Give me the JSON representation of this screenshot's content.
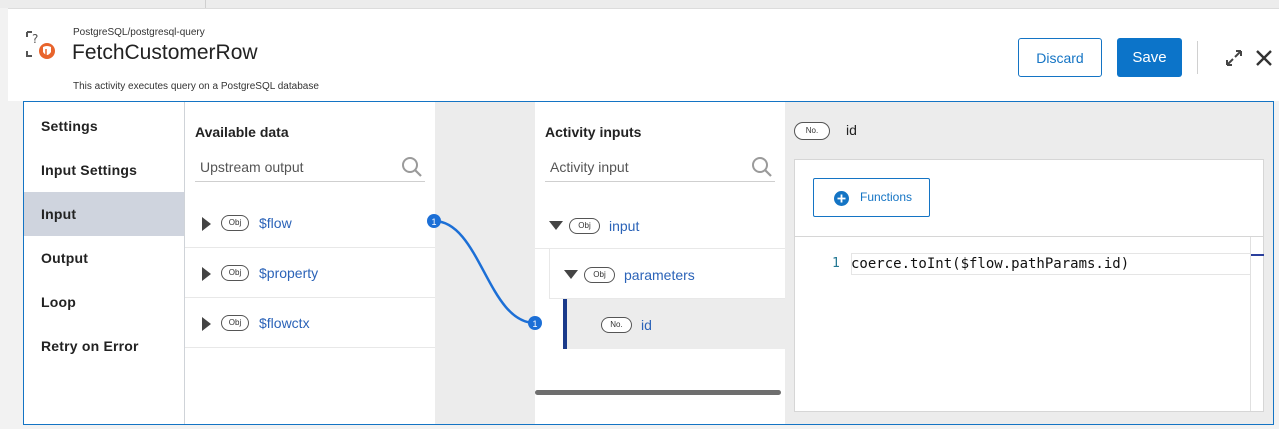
{
  "header": {
    "path": "PostgreSQL/postgresql-query",
    "title": "FetchCustomerRow",
    "description": "This activity executes query on a PostgreSQL database",
    "discard_label": "Discard",
    "save_label": "Save"
  },
  "nav": {
    "items": [
      {
        "label": "Settings"
      },
      {
        "label": "Input Settings"
      },
      {
        "label": "Input"
      },
      {
        "label": "Output"
      },
      {
        "label": "Loop"
      },
      {
        "label": "Retry on Error"
      }
    ],
    "active": "Input"
  },
  "available_data": {
    "title": "Available data",
    "search_placeholder": "Upstream output",
    "rows": [
      {
        "type": "Obj",
        "name": "$flow",
        "mapped_count": "1"
      },
      {
        "type": "Obj",
        "name": "$property"
      },
      {
        "type": "Obj",
        "name": "$flowctx"
      }
    ]
  },
  "activity_inputs": {
    "title": "Activity inputs",
    "search_placeholder": "Activity input",
    "tree": [
      {
        "type": "Obj",
        "name": "input",
        "expanded": true
      },
      {
        "type": "Obj",
        "name": "parameters",
        "expanded": true
      },
      {
        "type": "No.",
        "name": "id",
        "selected": true,
        "mapped_count": "1"
      }
    ]
  },
  "editor": {
    "field_type": "No.",
    "field_name": "id",
    "functions_label": "Functions",
    "line_number": "1",
    "expression": "coerce.toInt($flow.pathParams.id)"
  },
  "colors": {
    "accent": "#1474c4",
    "link": "#2b63b8",
    "active_nav": "#cfd4de",
    "connector": "#1c6fd6"
  }
}
